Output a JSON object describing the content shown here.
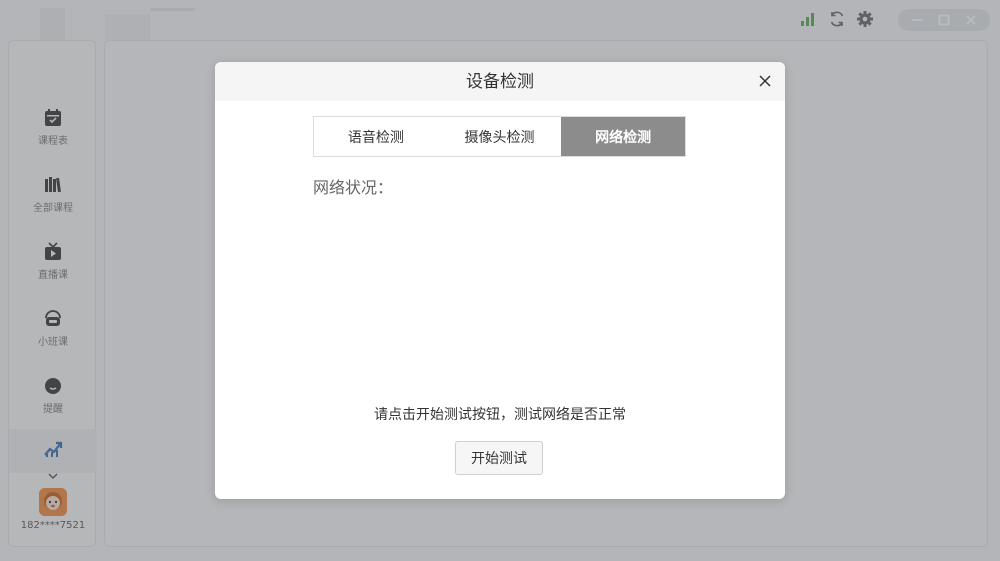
{
  "window": {
    "icons": [
      "signal-icon",
      "refresh-icon",
      "gear-icon",
      "minimize-icon",
      "maximize-icon",
      "close-icon"
    ],
    "accent_signal": "#4caf50"
  },
  "sidebar": {
    "items": [
      {
        "label": "课程表",
        "icon": "calendar-icon"
      },
      {
        "label": "全部课程",
        "icon": "books-icon"
      },
      {
        "label": "直播课",
        "icon": "tv-play-icon"
      },
      {
        "label": "小班课",
        "icon": "class-icon"
      },
      {
        "label": "提醒",
        "icon": "message-icon"
      },
      {
        "label": "",
        "icon": "chart-icon"
      }
    ],
    "phone": "182****7521"
  },
  "dialog": {
    "title": "设备检测",
    "tabs": [
      {
        "label": "语音检测",
        "active": false
      },
      {
        "label": "摄像头检测",
        "active": false
      },
      {
        "label": "网络检测",
        "active": true
      }
    ],
    "status_label": "网络状况：",
    "hint": "请点击开始测试按钮，测试网络是否正常",
    "start_button": "开始测试"
  },
  "colors": {
    "tab_active_bg": "#8c8c8c",
    "overlay": "rgba(90,92,98,0.42)"
  }
}
